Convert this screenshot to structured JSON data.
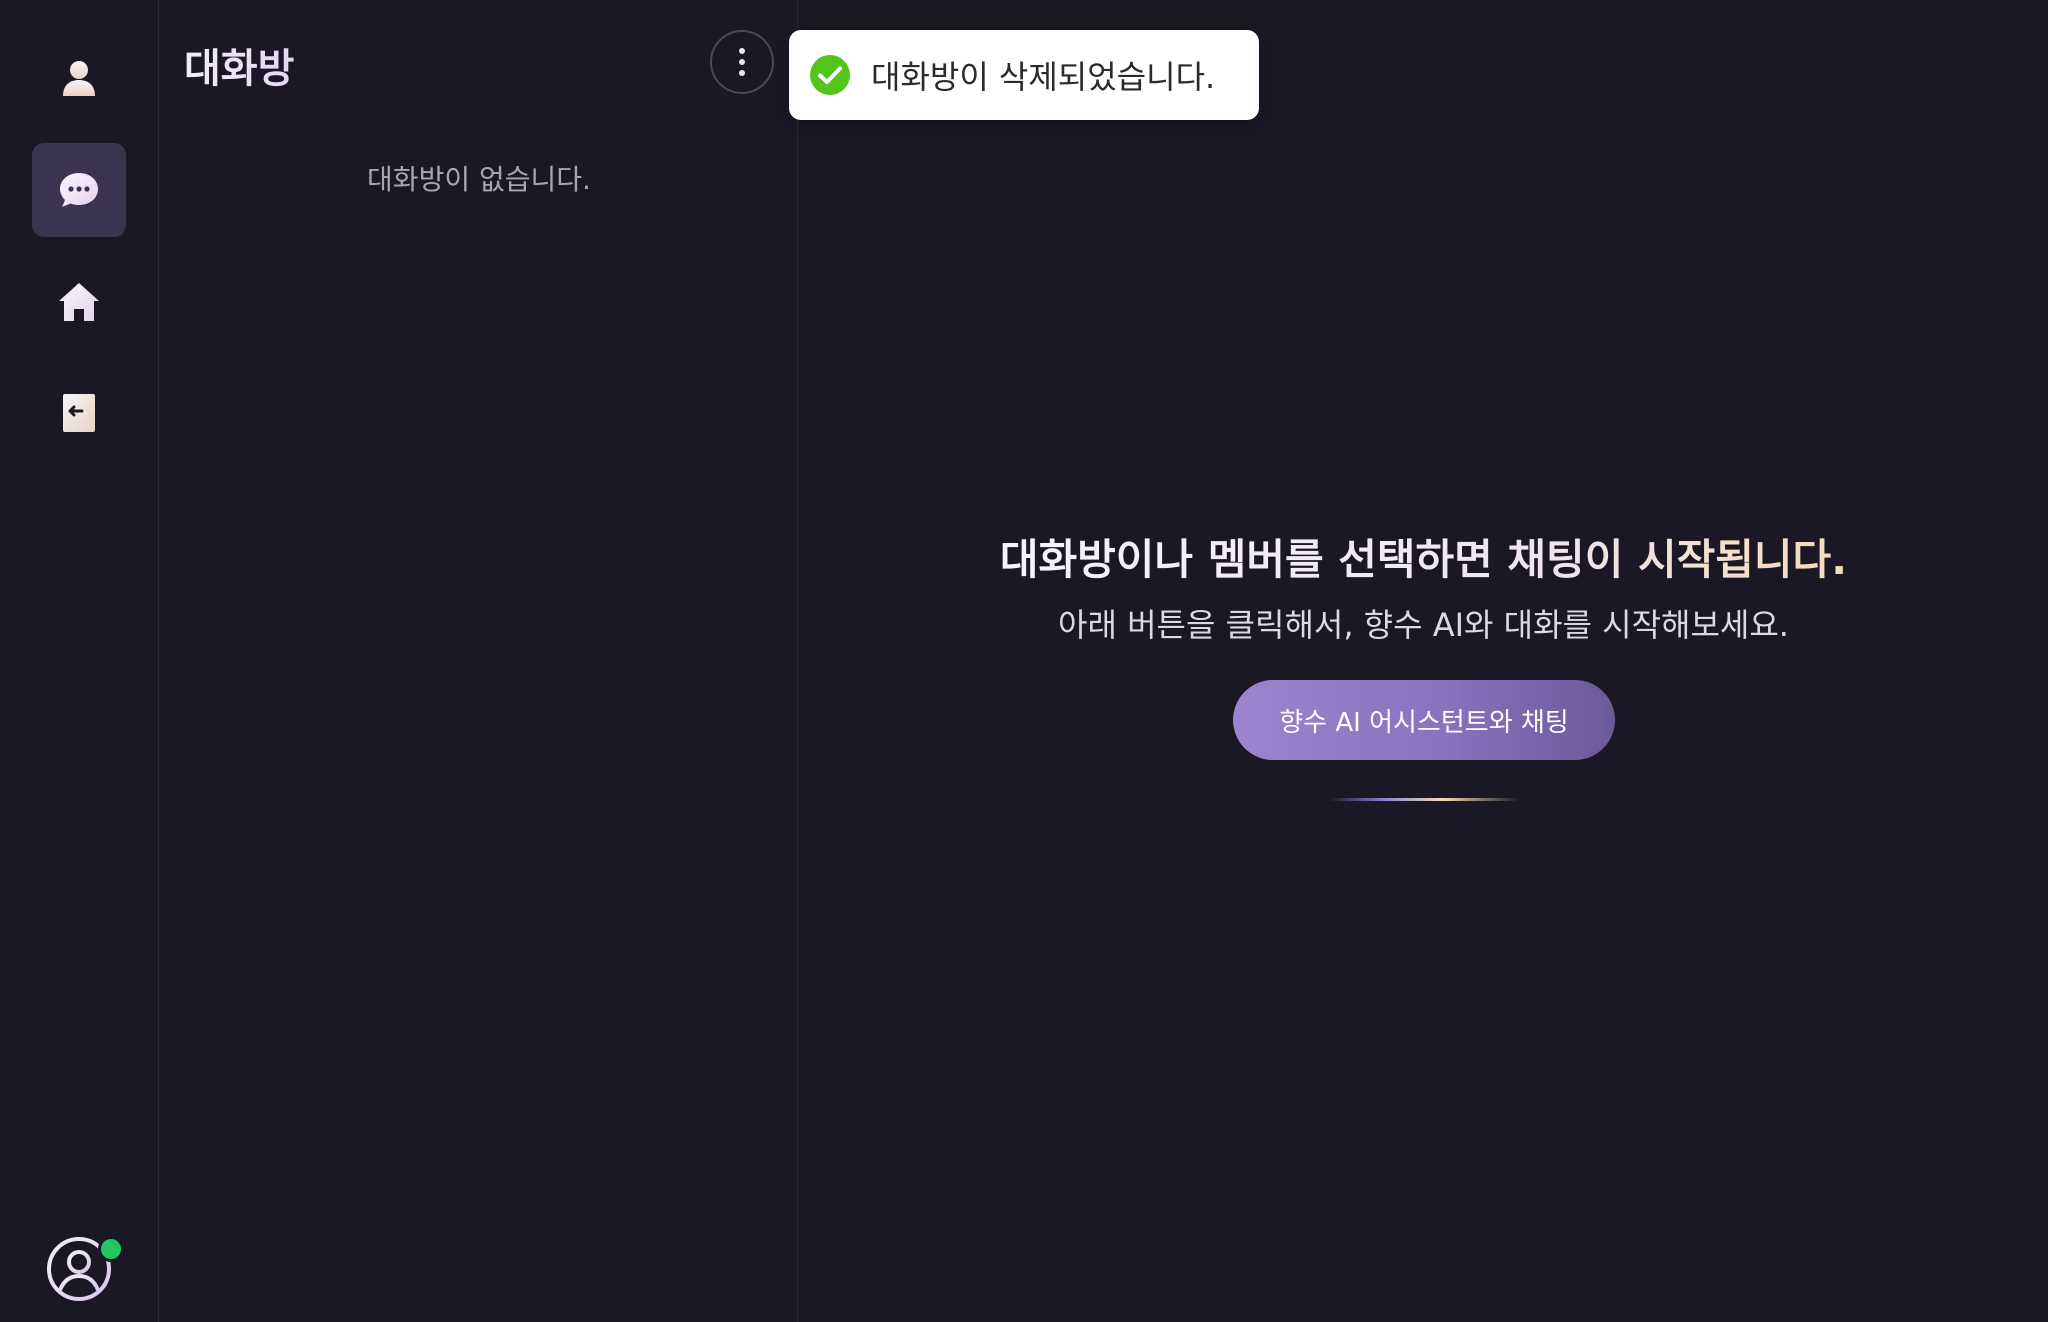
{
  "sidebar": {
    "items": [
      {
        "icon": "user-icon",
        "active": false
      },
      {
        "icon": "chat-bubble-icon",
        "active": true
      },
      {
        "icon": "home-icon",
        "active": false
      },
      {
        "icon": "logout-icon",
        "active": false
      }
    ],
    "profile": {
      "icon": "profile-avatar-icon",
      "status": "online",
      "status_color": "#22c55e"
    }
  },
  "chat_list": {
    "title": "대화방",
    "more_icon": "more-vertical-icon",
    "empty_message": "대화방이 없습니다."
  },
  "toast": {
    "icon": "success-check-icon",
    "message": "대화방이 삭제되었습니다.",
    "color": "#52c41a"
  },
  "main": {
    "title": "대화방이나 멤버를 선택하면 채팅이 시작됩니다.",
    "subtitle": "아래 버튼을 클릭해서, 향수 AI와 대화를 시작해보세요.",
    "cta_label": "향수 AI 어시스턴트와 채팅",
    "accent": "#9d84cf"
  }
}
